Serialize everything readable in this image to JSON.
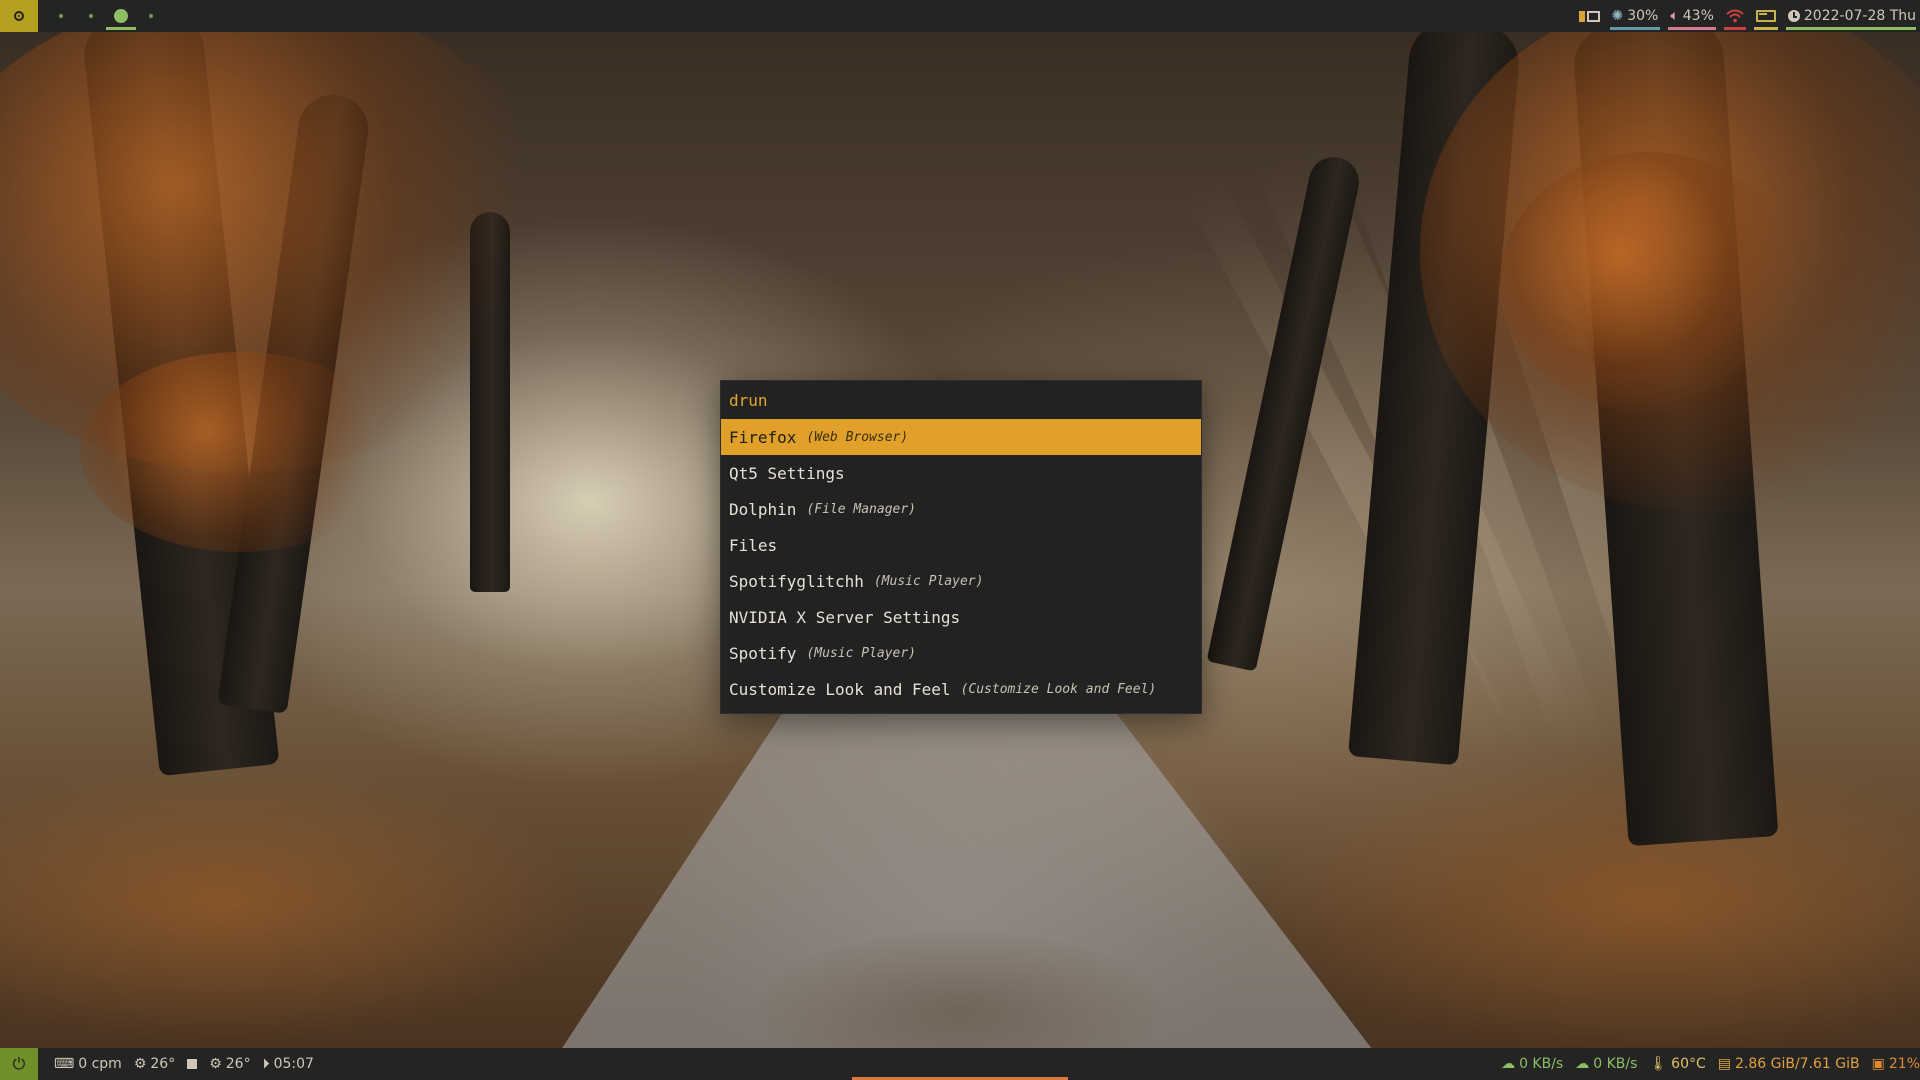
{
  "top_bar": {
    "workspaces": [
      {
        "id": "ws-1",
        "active": false
      },
      {
        "id": "ws-2",
        "active": false
      },
      {
        "id": "ws-3",
        "active": true
      },
      {
        "id": "ws-4",
        "active": false
      }
    ],
    "modules": {
      "layout": {
        "icon": "layout-tiled-icon"
      },
      "brightness": {
        "icon": "sun-icon",
        "value": "30%",
        "underline": "#5f9aa8"
      },
      "volume": {
        "icon": "speaker-icon",
        "value": "43%",
        "underline": "#d97a8a"
      },
      "wifi": {
        "icon": "wifi-icon",
        "underline": "#d04040"
      },
      "battery": {
        "icon": "battery-icon",
        "underline": "#c8b44a"
      },
      "clock": {
        "icon": "clock-icon",
        "value": "2022-07-28 Thu",
        "underline": "#8cbf63"
      }
    }
  },
  "launcher": {
    "prompt": "drun",
    "entries": [
      {
        "name": "Firefox",
        "desc": "(Web Browser)",
        "selected": true
      },
      {
        "name": "Qt5 Settings",
        "desc": ""
      },
      {
        "name": "Dolphin",
        "desc": "(File Manager)"
      },
      {
        "name": "Files",
        "desc": ""
      },
      {
        "name": "Spotifyglitchh",
        "desc": "(Music Player)"
      },
      {
        "name": "NVIDIA X Server Settings",
        "desc": ""
      },
      {
        "name": "Spotify",
        "desc": "(Music Player)"
      },
      {
        "name": "Customize Look and Feel",
        "desc": "(Customize Look and Feel)"
      }
    ]
  },
  "bottom_bar": {
    "left": {
      "typing_speed": {
        "icon": "keyboard-icon",
        "value": "0 cpm"
      },
      "cpu_temp_1": {
        "icon": "gear-icon",
        "value": "26°"
      },
      "stop": {
        "icon": "stop-icon"
      },
      "cpu_temp_2": {
        "icon": "gear-icon",
        "value": "26°"
      },
      "music_time": {
        "icon": "next-track-icon",
        "value": "05:07"
      }
    },
    "right": {
      "download": {
        "icon": "cloud-download-icon",
        "value": "0 KB/s"
      },
      "upload": {
        "icon": "cloud-upload-icon",
        "value": "0 KB/s"
      },
      "temperature": {
        "icon": "thermometer-icon",
        "value": "60°C"
      },
      "memory": {
        "icon": "memory-icon",
        "value": "2.86 GiB/7.61 GiB"
      },
      "cpu": {
        "icon": "cpu-icon",
        "value": "21%"
      }
    }
  },
  "colors": {
    "accent": "#e0a02a",
    "bar_bg": "#242424",
    "launcher_bg": "#222222",
    "green": "#8cbf63",
    "olive": "#b5a020"
  }
}
